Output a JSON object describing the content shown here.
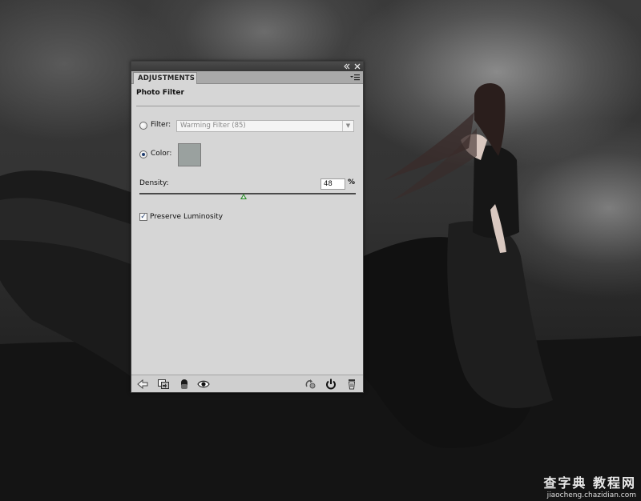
{
  "panel": {
    "tab_label": "ADJUSTMENTS",
    "title": "Photo Filter",
    "titlebar_collapse_icon": "double-chevron-left-icon",
    "titlebar_close_icon": "close-icon",
    "menu_icon": "panel-menu-icon"
  },
  "filter": {
    "label": "Filter:",
    "selected": false,
    "value": "Warming Filter (85)"
  },
  "color": {
    "label": "Color:",
    "selected": true,
    "swatch": "#9aa19f"
  },
  "density": {
    "label": "Density:",
    "value": "48",
    "unit": "%",
    "fraction": 0.48
  },
  "preserve_luminosity": {
    "label": "Preserve Luminosity",
    "checked": true
  },
  "bottom_toolbar": {
    "left_icons": [
      "back-arrow-icon",
      "clip-to-layer-icon",
      "layer-mask-icon",
      "visibility-eye-icon"
    ],
    "right_icons": [
      "previous-state-icon",
      "reset-icon",
      "trash-icon"
    ]
  },
  "watermark": {
    "title": "查字典 教程网",
    "url": "jiaocheng.chazidian.com"
  },
  "colors": {
    "panel_bg": "#d6d6d6",
    "slider_thumb": "#2c8f2c",
    "radio_dot": "#1d3b6e"
  }
}
